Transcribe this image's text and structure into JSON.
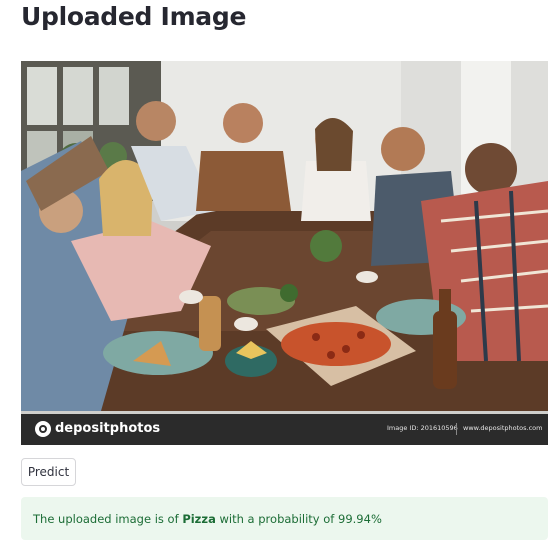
{
  "page": {
    "title": "Uploaded Image"
  },
  "image": {
    "watermark_brand": "depositphotos",
    "image_id_text": "Image ID: 201610596",
    "site_text": "www.depositphotos.com"
  },
  "predict_button": {
    "label": "Predict"
  },
  "result": {
    "prefix": "The uploaded image is of ",
    "label": "Pizza",
    "middle": " with a probability of ",
    "probability": "99.94%"
  },
  "colors": {
    "success_bg": "#ecf7ee",
    "success_text": "#1c6d36",
    "title_text": "#262730",
    "button_border": "#d6d6d9"
  }
}
